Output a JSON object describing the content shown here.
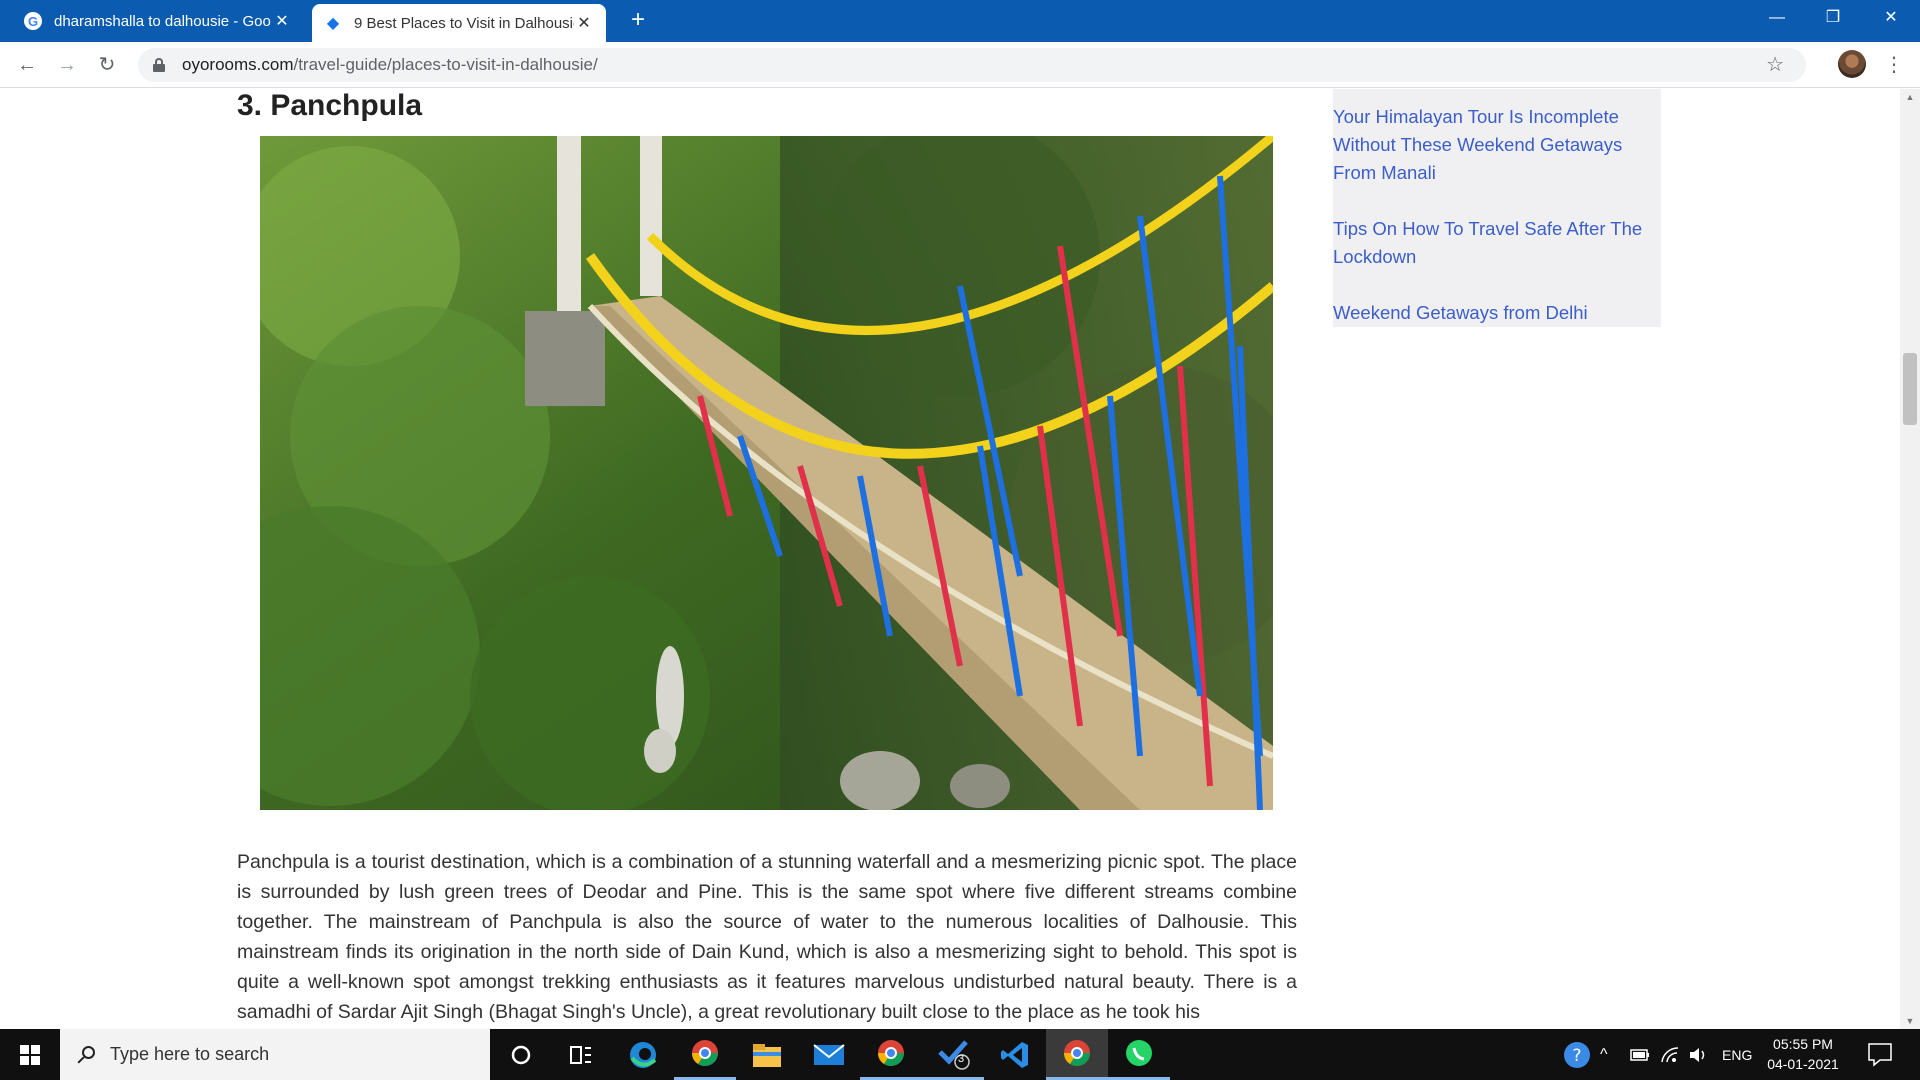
{
  "browser": {
    "tabs": [
      {
        "title": "dharamshalla to dalhousie - Goo",
        "icon": "google-icon",
        "active": false
      },
      {
        "title": "9 Best Places to Visit in Dalhousie",
        "icon": "oyo-icon",
        "active": true
      }
    ],
    "new_tab_label": "+",
    "window_controls": {
      "minimize": "—",
      "restore": "❐",
      "close": "✕"
    },
    "address": {
      "domain": "oyorooms.com",
      "path": "/travel-guide/places-to-visit-in-dalhousie/"
    }
  },
  "article": {
    "heading": "3. Panchpula",
    "image_alt": "Colorful rope suspension bridge in forest",
    "paragraph": "Panchpula is a tourist destination, which is a combination of a stunning waterfall and a mesmerizing picnic spot. The place is surrounded by lush green trees of Deodar and Pine. This is the same spot where five different streams combine together. The mainstream of Panchpula is also the source of water to the numerous localities of Dalhousie. This mainstream finds its origination in the north side of Dain Kund, which is also a mesmerizing sight to behold. This spot is quite a well-known spot amongst trekking enthusiasts as it features marvelous undisturbed natural beauty. There is a samadhi of Sardar Ajit Singh (Bhagat Singh's Uncle), a great revolutionary built close to the place as he took his"
  },
  "sidebar": {
    "links": [
      "Your Himalayan Tour Is Incomplete Without These Weekend Getaways From Manali",
      "Tips On How To Travel Safe After The Lockdown",
      "Weekend Getaways from Delhi"
    ]
  },
  "taskbar": {
    "search_placeholder": "Type here to search",
    "apps": [
      "cortana-icon",
      "task-view-icon",
      "edge-icon",
      "chrome-icon",
      "file-explorer-icon",
      "mail-icon",
      "chrome-profile-icon",
      "todo-icon",
      "vscode-icon",
      "chrome-active-icon",
      "whatsapp-icon"
    ],
    "todo_badge": "3",
    "language": "ENG",
    "time": "05:55 PM",
    "date": "04-01-2021"
  },
  "colors": {
    "titlebar": "#0b5cb0",
    "link": "#3b5ec9",
    "taskbar": "#101010"
  }
}
